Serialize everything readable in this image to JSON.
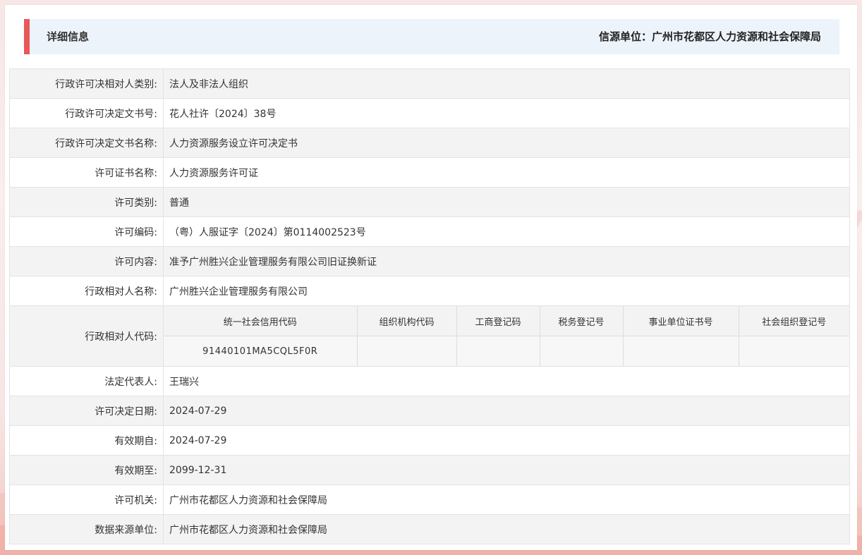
{
  "header": {
    "title": "详细信息",
    "source_label": "信源单位：广州市花都区人力资源和社会保障局"
  },
  "colors": {
    "accent_bar": "#e8575a",
    "header_bg": "#edf3fb",
    "row_stripe": "#f3f3f3"
  },
  "rows": [
    {
      "label": "行政许可决相对人类别:",
      "value": "法人及非法人组织"
    },
    {
      "label": "行政许可决定文书号:",
      "value": "花人社许〔2024〕38号"
    },
    {
      "label": "行政许可决定文书名称:",
      "value": "人力资源服务设立许可决定书"
    },
    {
      "label": "许可证书名称:",
      "value": "人力资源服务许可证"
    },
    {
      "label": "许可类别:",
      "value": "普通"
    },
    {
      "label": "许可编码:",
      "value": "（粤）人服证字〔2024〕第0114002523号"
    },
    {
      "label": "许可内容:",
      "value": "准予广州胜兴企业管理服务有限公司旧证换新证"
    },
    {
      "label": "行政相对人名称:",
      "value": "广州胜兴企业管理服务有限公司"
    }
  ],
  "codes": {
    "label": "行政相对人代码:",
    "headers": [
      "统一社会信用代码",
      "组织机构代码",
      "工商登记码",
      "税务登记号",
      "事业单位证书号",
      "社会组织登记号"
    ],
    "values": [
      "91440101MA5CQL5F0R",
      "",
      "",
      "",
      "",
      ""
    ]
  },
  "rows_after": [
    {
      "label": "法定代表人:",
      "value": "王瑞兴"
    },
    {
      "label": "许可决定日期:",
      "value": "2024-07-29"
    },
    {
      "label": "有效期自:",
      "value": "2024-07-29"
    },
    {
      "label": "有效期至:",
      "value": "2099-12-31"
    },
    {
      "label": "许可机关:",
      "value": "广州市花都区人力资源和社会保障局"
    },
    {
      "label": "数据来源单位:",
      "value": "广州市花都区人力资源和社会保障局"
    }
  ]
}
